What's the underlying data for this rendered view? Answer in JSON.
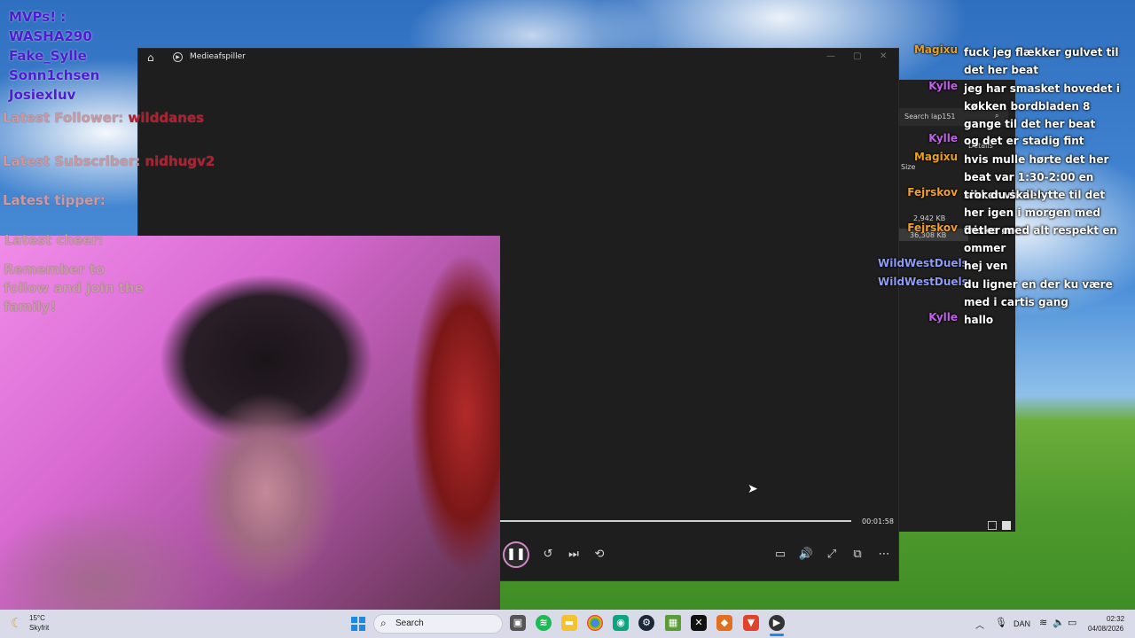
{
  "overlay": {
    "mvp_lines": [
      "MVPs! :",
      "WASHA290",
      "Fake_Sylle",
      "Sonn1chsen",
      "Josiexluv"
    ],
    "latest_follower_label": "Latest Follower:",
    "latest_follower_value": "wilddanes",
    "latest_subscriber_label": "Latest Subscriber:",
    "latest_subscriber_value": "nidhugv2",
    "latest_tipper_label": "Latest tipper:",
    "latest_cheer_label": "Latest cheer:",
    "reminder_lines": [
      "Remember to",
      "follow and join the",
      "family!"
    ]
  },
  "player": {
    "title": "Medieafspiller",
    "time_elapsed": "00:01:58",
    "progress": 0.0,
    "icons": [
      "home-icon",
      "app-play-icon",
      "pause-icon",
      "rewind-10-icon",
      "skip-next-icon",
      "repeat-icon",
      "subtitles-icon",
      "volume-icon",
      "fullscreen-icon",
      "miniplayer-icon",
      "more-icon"
    ],
    "accent": "#d28ac7"
  },
  "explorer": {
    "search": "Search lap151",
    "details": "Details",
    "size_header": "Size",
    "size1": "2,942 KB",
    "size2": "36,308 KB"
  },
  "chat": [
    {
      "name": "Magixu",
      "color": "#e8a020",
      "message": "fuck jeg flækker gulvet til det her beat"
    },
    {
      "name": "Kylle",
      "color": "#c060e8",
      "message": "jeg har smasket hovedet i køkken bordbladen 8 gange til det her beat"
    },
    {
      "name": "Kylle",
      "color": "#c060e8",
      "message": "og det er stadig fint"
    },
    {
      "name": "Magixu",
      "color": "#e8a020",
      "message": "hvis mulle hørte det her beat var 1:30-2:00 en sikker vinder"
    },
    {
      "name": "Fejrskov",
      "color": "#f0a030",
      "message": "tror du skal lytte til det her igen i morgen med friske ører"
    },
    {
      "name": "Fejrskov",
      "color": "#f0a030",
      "message": "det er med alt respekt en ommer"
    },
    {
      "name": "WildWestDuels",
      "color": "#8f9cf5",
      "message": "hej ven"
    },
    {
      "name": "WildWestDuels",
      "color": "#8f9cf5",
      "message": "du ligner en der ku være med i cartis gang"
    },
    {
      "name": "Kylle",
      "color": "#c060e8",
      "message": "hallo"
    }
  ],
  "taskbar": {
    "weather_temp": "15°C",
    "weather_desc": "Skyfrit",
    "search_label": "Search",
    "language": "DAN",
    "time": "02:32",
    "date": "04/08/2026",
    "apps": [
      "start-icon",
      "task-view-icon",
      "spotify-icon",
      "file-explorer-icon",
      "chrome-icon",
      "app-green-icon",
      "steam-icon",
      "minecraft-icon",
      "capcut-icon",
      "app-orange-icon",
      "brave-icon",
      "media-player-icon"
    ]
  }
}
